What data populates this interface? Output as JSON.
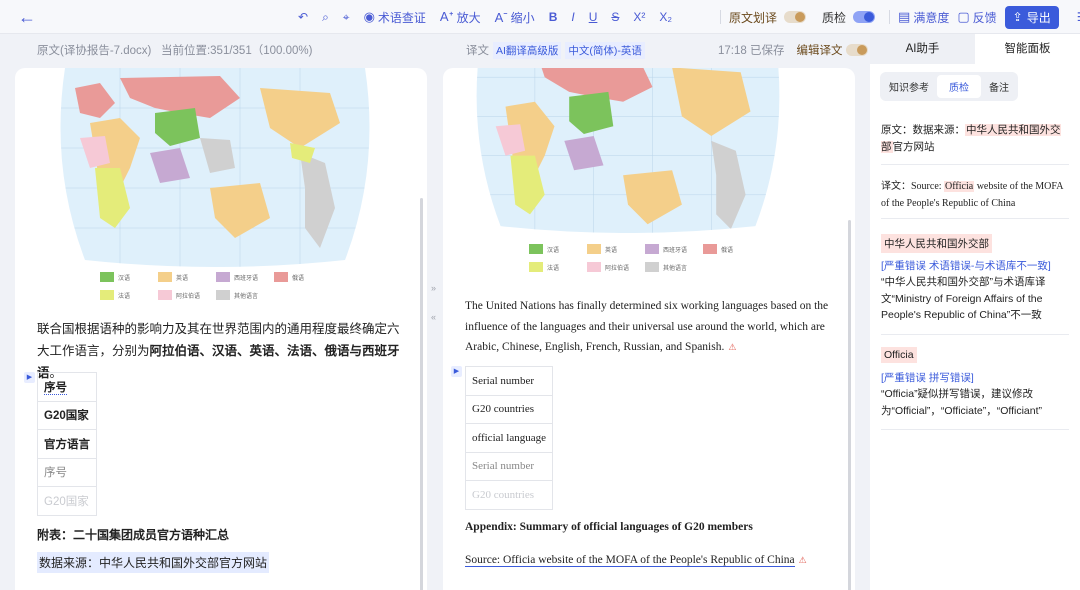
{
  "toolbar": {
    "undo": "↶",
    "search": "⌕",
    "locate": "⌖",
    "term_check": "术语查证",
    "zoom_in": "放大",
    "zoom_out": "缩小",
    "bold": "B",
    "italic": "I",
    "underline": "U",
    "strike": "S",
    "superscript": "X²",
    "subscript": "X₂",
    "source_underline": "原文划译",
    "quality_check": "质检",
    "satisfaction": "满意度",
    "feedback": "反馈",
    "export": "导出"
  },
  "subheader": {
    "doc_info": "原文(译协报告-7.docx)   当前位置:351/351（100.00%)",
    "translation_label": "译文",
    "engine_tag": "AI翻译高级版",
    "lang_tag": "中文(简体)-英语",
    "saved_status": "17:18 已保存",
    "edit_translation": "编辑译文"
  },
  "map_legend": {
    "row1": [
      "汉语",
      "英语",
      "西班牙语",
      "俄语"
    ],
    "row2": [
      "法语",
      "阿拉伯语",
      "其他语言"
    ],
    "colors": [
      "#7cc35c",
      "#f4cf8a",
      "#c6a9d2",
      "#e99a98",
      "#e4ec7a",
      "#f6c9d6",
      "#d0d0d0"
    ]
  },
  "source": {
    "para_plain": "联合国根据语种的影响力及其在世界范围内的通用程度最终确定六大工作语言，分别为",
    "para_bold": "阿拉伯语、汉语、英语、法语、俄语与西班牙语",
    "para_end": "。",
    "table": [
      "序号",
      "G20国家",
      "官方语言",
      "序号",
      "G20国家"
    ],
    "appendix": "附表：二十国集团成员官方语种汇总",
    "source_line": "数据来源：中华人民共和国外交部官方网站"
  },
  "target": {
    "para": "The United Nations has finally determined six working languages based on the influence of the languages and their universal use around the world, which are Arabic, Chinese, English, French, Russian, and Spanish.",
    "table": [
      "Serial number",
      "G20 countries",
      "official language",
      "Serial number",
      "G20 countries"
    ],
    "appendix": "Appendix: Summary of official languages of G20 members",
    "source_line": "Source: Officia website of the MOFA of the People's Republic of China"
  },
  "right_panel": {
    "tabs": [
      "AI助手",
      "智能面板"
    ],
    "subtabs": [
      "知识参考",
      "质检",
      "备注"
    ],
    "orig_prefix": "原文：数据来源：",
    "orig_hl": "中华人民共和国外交部",
    "orig_suffix": "官方网站",
    "trans_prefix": "译文：Source: ",
    "trans_hl": "Officia",
    "trans_suffix": " website of the MOFA of the People's Republic of China",
    "issue1_term": "中华人民共和国外交部",
    "issue1_type": "[严重错误 术语错误-与术语库不一致]",
    "issue1_desc": "“中华人民共和国外交部”与术语库译文“Ministry of Foreign Affairs of the People's Republic of China”不一致",
    "issue2_term": "Officia",
    "issue2_type": "[严重错误 拼写错误]",
    "issue2_desc": "“Officia”疑似拼写错误，建议修改为“Official”，“Officiate”，“Officiant”"
  }
}
